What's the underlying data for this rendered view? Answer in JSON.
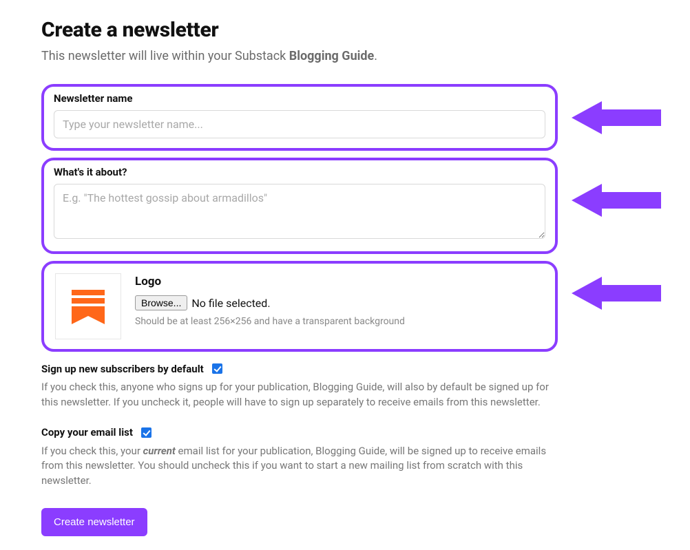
{
  "header": {
    "title": "Create a newsletter",
    "subtitle_pre": "This newsletter will live within your Substack ",
    "subtitle_bold": "Blogging Guide",
    "subtitle_post": "."
  },
  "name_field": {
    "label": "Newsletter name",
    "placeholder": "Type your newsletter name...",
    "value": ""
  },
  "about_field": {
    "label": "What's it about?",
    "placeholder": "E.g. \"The hottest gossip about armadillos\"",
    "value": ""
  },
  "logo": {
    "label": "Logo",
    "browse_label": "Browse...",
    "file_status": "No file selected.",
    "hint": "Should be at least 256×256 and have a transparent background"
  },
  "default_signup": {
    "label": "Sign up new subscribers by default",
    "checked": true,
    "desc": "If you check this, anyone who signs up for your publication, Blogging Guide, will also by default be signed up for this newsletter. If you uncheck it, people will have to sign up separately to receive emails from this newsletter."
  },
  "copy_list": {
    "label": "Copy your email list",
    "checked": true,
    "desc_pre": "If you check this, your ",
    "desc_em": "current",
    "desc_post": " email list for your publication, Blogging Guide, will be signed up to receive emails from this newsletter. You should uncheck this if you want to start a new mailing list from scratch with this newsletter."
  },
  "submit": {
    "label": "Create newsletter"
  },
  "colors": {
    "accent": "#8b3dff",
    "substack_orange": "#ff6719"
  }
}
